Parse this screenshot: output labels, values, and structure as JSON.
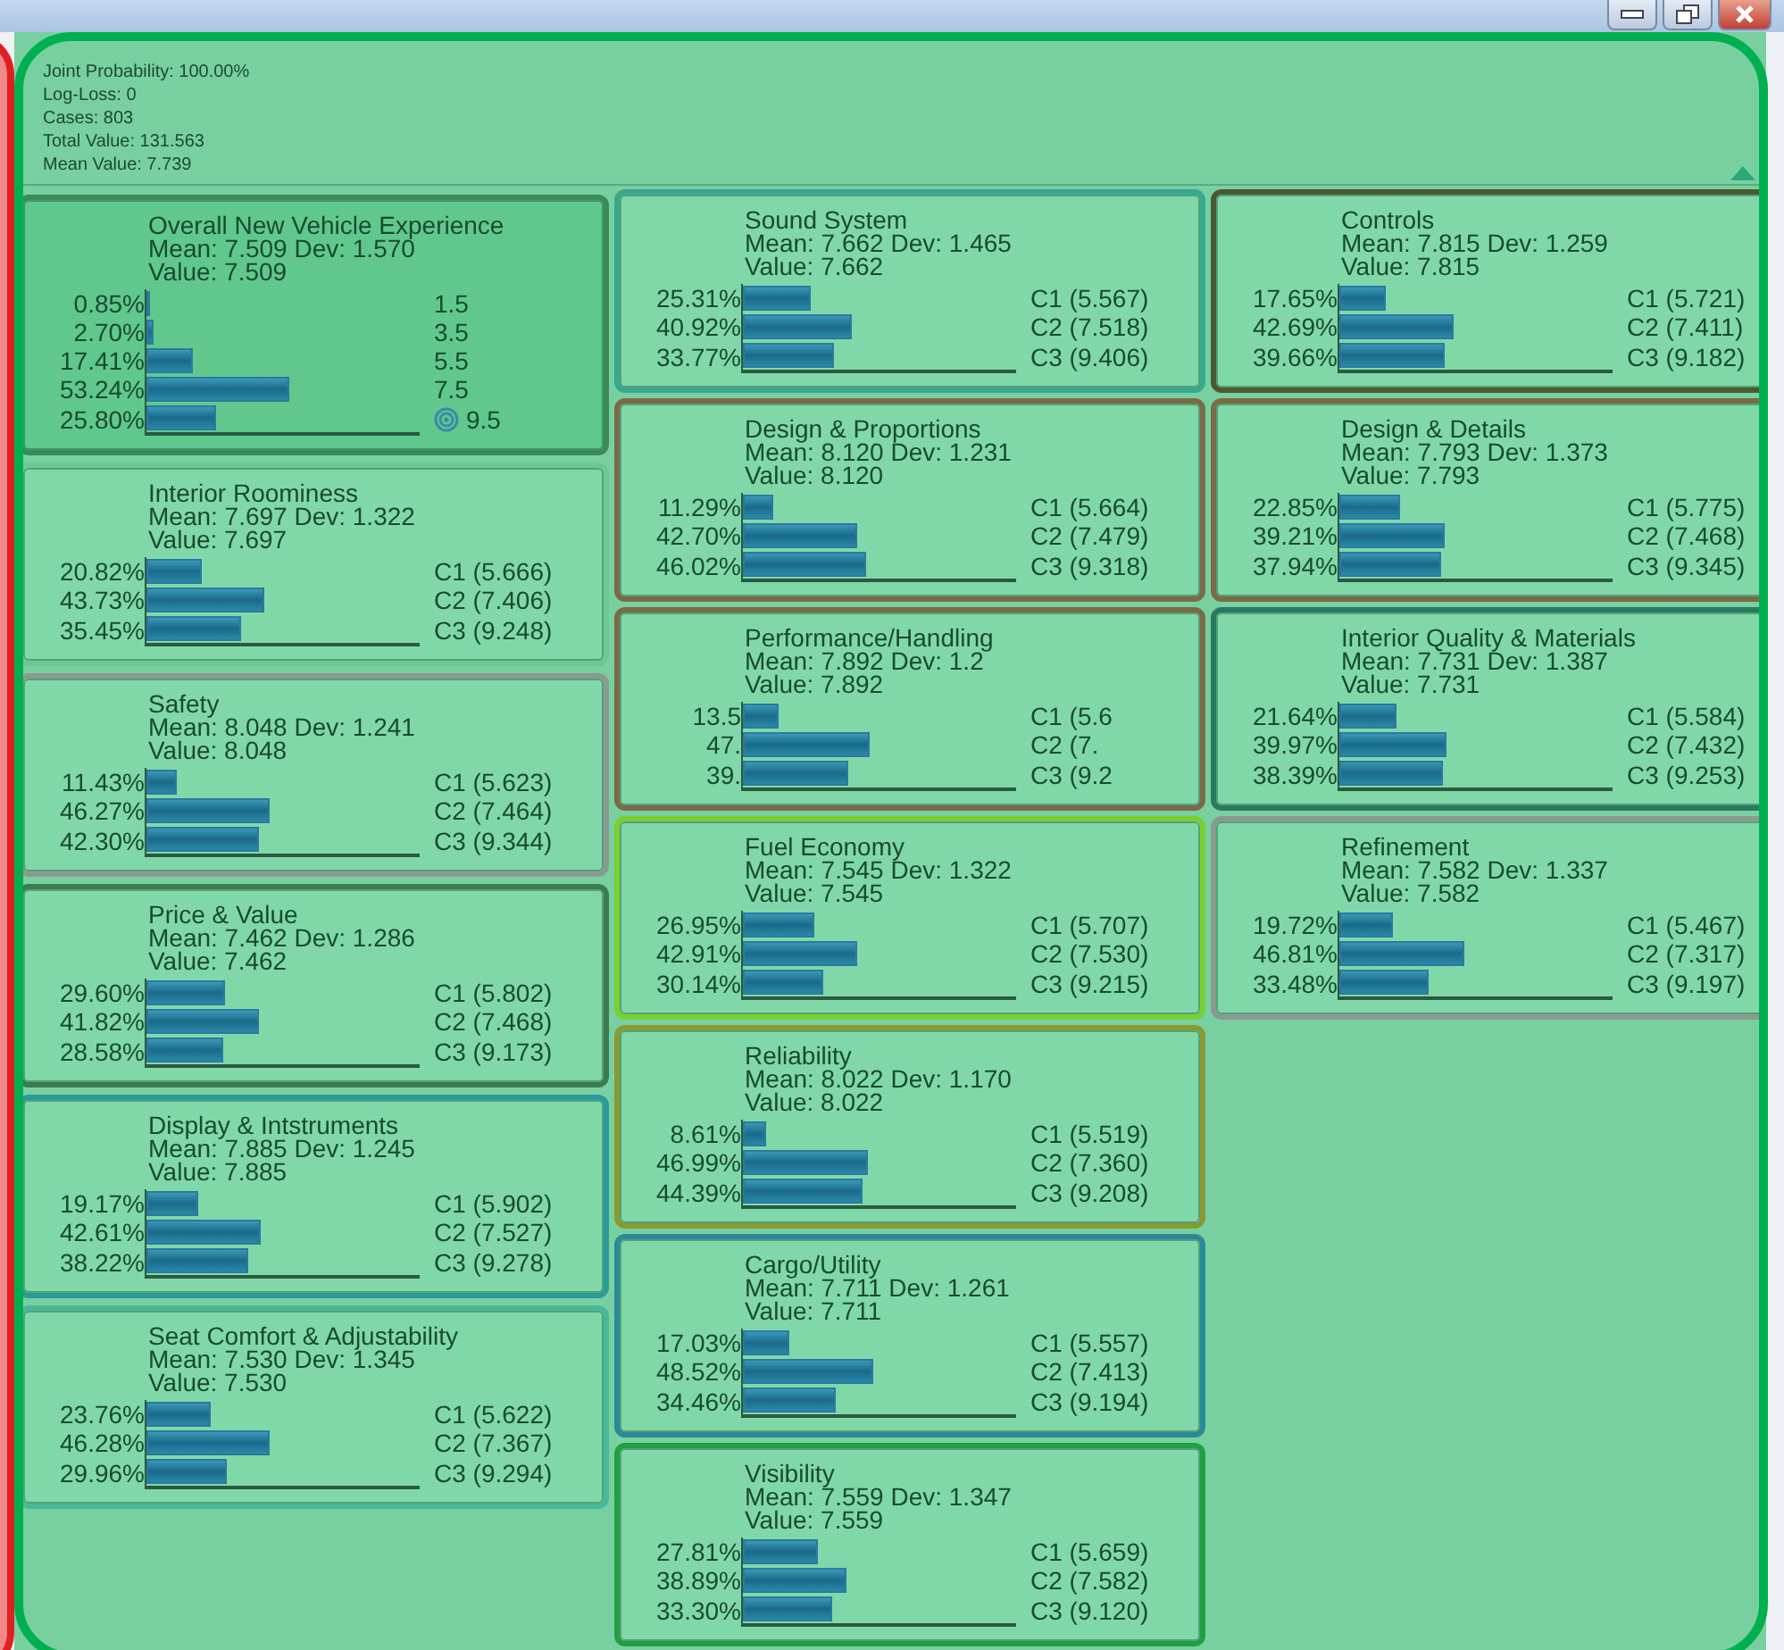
{
  "header": {
    "lines": [
      "Joint Probability: 100.00%",
      "Log-Loss: 0",
      "Cases: 803",
      "Total Value: 131.563",
      "Mean Value: 7.739"
    ]
  },
  "columns": [
    [
      {
        "title": "Overall New Vehicle Experience",
        "stats": "Mean: 7.509 Dev: 1.570",
        "value": "Value: 7.509",
        "color": "#3a8a5a",
        "selected": true,
        "rows": [
          {
            "percent": "0.85%",
            "level": 0.0085,
            "label": "1.5",
            "target": false
          },
          {
            "percent": "2.70%",
            "level": 0.027,
            "label": "3.5",
            "target": false
          },
          {
            "percent": "17.41%",
            "level": 0.1741,
            "label": "5.5",
            "target": false
          },
          {
            "percent": "53.24%",
            "level": 0.5324,
            "label": "7.5",
            "target": false
          },
          {
            "percent": "25.80%",
            "level": 0.258,
            "label": "9.5",
            "target": true
          }
        ]
      },
      {
        "title": "Interior Roominess",
        "stats": "Mean: 7.697 Dev: 1.322",
        "value": "Value: 7.697",
        "color": "#6cc890",
        "selected": false,
        "rows": [
          {
            "percent": "20.82%",
            "level": 0.2082,
            "label": "C1 (5.666)"
          },
          {
            "percent": "43.73%",
            "level": 0.4373,
            "label": "C2 (7.406)"
          },
          {
            "percent": "35.45%",
            "level": 0.3545,
            "label": "C3 (9.248)"
          }
        ]
      },
      {
        "title": "Safety",
        "stats": "Mean: 8.048 Dev: 1.241",
        "value": "Value: 8.048",
        "color": "#8a9a90",
        "selected": false,
        "rows": [
          {
            "percent": "11.43%",
            "level": 0.1143,
            "label": "C1 (5.623)"
          },
          {
            "percent": "46.27%",
            "level": 0.4627,
            "label": "C2 (7.464)"
          },
          {
            "percent": "42.30%",
            "level": 0.423,
            "label": "C3 (9.344)"
          }
        ]
      },
      {
        "title": "Price & Value",
        "stats": "Mean: 7.462 Dev: 1.286",
        "value": "Value: 7.462",
        "color": "#3c7a50",
        "selected": false,
        "rows": [
          {
            "percent": "29.60%",
            "level": 0.296,
            "label": "C1 (5.802)"
          },
          {
            "percent": "41.82%",
            "level": 0.4182,
            "label": "C2 (7.468)"
          },
          {
            "percent": "28.58%",
            "level": 0.2858,
            "label": "C3 (9.173)"
          }
        ]
      },
      {
        "title": "Display & Intstruments",
        "stats": "Mean: 7.885 Dev: 1.245",
        "value": "Value: 7.885",
        "color": "#2a9a9a",
        "selected": false,
        "rows": [
          {
            "percent": "19.17%",
            "level": 0.1917,
            "label": "C1 (5.902)"
          },
          {
            "percent": "42.61%",
            "level": 0.4261,
            "label": "C2 (7.527)"
          },
          {
            "percent": "38.22%",
            "level": 0.3822,
            "label": "C3 (9.278)"
          }
        ]
      },
      {
        "title": "Seat Comfort & Adjustability",
        "stats": "Mean: 7.530 Dev: 1.345",
        "value": "Value: 7.530",
        "color": "#48b898",
        "selected": false,
        "rows": [
          {
            "percent": "23.76%",
            "level": 0.2376,
            "label": "C1 (5.622)"
          },
          {
            "percent": "46.28%",
            "level": 0.4628,
            "label": "C2 (7.367)"
          },
          {
            "percent": "29.96%",
            "level": 0.2996,
            "label": "C3 (9.294)"
          }
        ]
      }
    ],
    [
      {
        "title": "Sound System",
        "stats": "Mean: 7.662 Dev: 1.465",
        "value": "Value: 7.662",
        "color": "#38a890",
        "selected": false,
        "rows": [
          {
            "percent": "25.31%",
            "level": 0.2531,
            "label": "C1 (5.567)"
          },
          {
            "percent": "40.92%",
            "level": 0.4092,
            "label": "C2 (7.518)"
          },
          {
            "percent": "33.77%",
            "level": 0.3377,
            "label": "C3 (9.406)"
          }
        ]
      },
      {
        "title": "Design & Proportions",
        "stats": "Mean: 8.120 Dev: 1.231",
        "value": "Value: 8.120",
        "color": "#7a6a48",
        "selected": false,
        "rows": [
          {
            "percent": "11.29%",
            "level": 0.1129,
            "label": "C1 (5.664)"
          },
          {
            "percent": "42.70%",
            "level": 0.427,
            "label": "C2 (7.479)"
          },
          {
            "percent": "46.02%",
            "level": 0.4602,
            "label": "C3 (9.318)"
          }
        ]
      },
      {
        "title": "Performance/Handling",
        "stats": "Mean: 7.892 Dev: 1.2",
        "value": "Value: 7.892",
        "color": "#7a6a48",
        "selected": false,
        "rows": [
          {
            "percent": "13.5",
            "level": 0.135,
            "label": "C1 (5.6"
          },
          {
            "percent": "47.",
            "level": 0.47,
            "label": "C2 (7."
          },
          {
            "percent": "39.",
            "level": 0.39,
            "label": "C3 (9.2"
          }
        ]
      },
      {
        "title": "Fuel Economy",
        "stats": "Mean: 7.545 Dev: 1.322",
        "value": "Value: 7.545",
        "color": "#78d030",
        "selected": false,
        "rows": [
          {
            "percent": "26.95%",
            "level": 0.2695,
            "label": "C1 (5.707)"
          },
          {
            "percent": "42.91%",
            "level": 0.4291,
            "label": "C2 (7.530)"
          },
          {
            "percent": "30.14%",
            "level": 0.3014,
            "label": "C3 (9.215)"
          }
        ]
      },
      {
        "title": "Reliability",
        "stats": "Mean: 8.022 Dev: 1.170",
        "value": "Value: 8.022",
        "color": "#8a9a30",
        "selected": false,
        "rows": [
          {
            "percent": "8.61%",
            "level": 0.0861,
            "label": "C1 (5.519)"
          },
          {
            "percent": "46.99%",
            "level": 0.4699,
            "label": "C2 (7.360)"
          },
          {
            "percent": "44.39%",
            "level": 0.4439,
            "label": "C3 (9.208)"
          }
        ]
      },
      {
        "title": "Cargo/Utility",
        "stats": "Mean: 7.711 Dev: 1.261",
        "value": "Value: 7.711",
        "color": "#2a8a98",
        "selected": false,
        "rows": [
          {
            "percent": "17.03%",
            "level": 0.1703,
            "label": "C1 (5.557)"
          },
          {
            "percent": "48.52%",
            "level": 0.4852,
            "label": "C2 (7.413)"
          },
          {
            "percent": "34.46%",
            "level": 0.3446,
            "label": "C3 (9.194)"
          }
        ]
      },
      {
        "title": "Visibility",
        "stats": "Mean: 7.559 Dev: 1.347",
        "value": "Value: 7.559",
        "color": "#20a040",
        "selected": false,
        "rows": [
          {
            "percent": "27.81%",
            "level": 0.2781,
            "label": "C1 (5.659)"
          },
          {
            "percent": "38.89%",
            "level": 0.3889,
            "label": "C2 (7.582)"
          },
          {
            "percent": "33.30%",
            "level": 0.333,
            "label": "C3 (9.120)"
          }
        ]
      }
    ],
    [
      {
        "title": "Controls",
        "stats": "Mean: 7.815 Dev: 1.259",
        "value": "Value: 7.815",
        "color": "#4a5a30",
        "selected": false,
        "rows": [
          {
            "percent": "17.65%",
            "level": 0.1765,
            "label": "C1 (5.721)"
          },
          {
            "percent": "42.69%",
            "level": 0.4269,
            "label": "C2 (7.411)"
          },
          {
            "percent": "39.66%",
            "level": 0.3966,
            "label": "C3 (9.182)"
          }
        ]
      },
      {
        "title": "Design & Details",
        "stats": "Mean: 7.793 Dev: 1.373",
        "value": "Value: 7.793",
        "color": "#7a6a48",
        "selected": false,
        "rows": [
          {
            "percent": "22.85%",
            "level": 0.2285,
            "label": "C1 (5.775)"
          },
          {
            "percent": "39.21%",
            "level": 0.3921,
            "label": "C2 (7.468)"
          },
          {
            "percent": "37.94%",
            "level": 0.3794,
            "label": "C3 (9.345)"
          }
        ]
      },
      {
        "title": "Interior Quality & Materials",
        "stats": "Mean: 7.731 Dev: 1.387",
        "value": "Value: 7.731",
        "color": "#2a7a60",
        "selected": false,
        "rows": [
          {
            "percent": "21.64%",
            "level": 0.2164,
            "label": "C1 (5.584)"
          },
          {
            "percent": "39.97%",
            "level": 0.3997,
            "label": "C2 (7.432)"
          },
          {
            "percent": "38.39%",
            "level": 0.3839,
            "label": "C3 (9.253)"
          }
        ]
      },
      {
        "title": "Refinement",
        "stats": "Mean: 7.582 Dev: 1.337",
        "value": "Value: 7.582",
        "color": "#8a9a90",
        "selected": false,
        "rows": [
          {
            "percent": "19.72%",
            "level": 0.1972,
            "label": "C1 (5.467)"
          },
          {
            "percent": "46.81%",
            "level": 0.4681,
            "label": "C2 (7.317)"
          },
          {
            "percent": "33.48%",
            "level": 0.3348,
            "label": "C3 (9.197)"
          }
        ]
      }
    ]
  ]
}
